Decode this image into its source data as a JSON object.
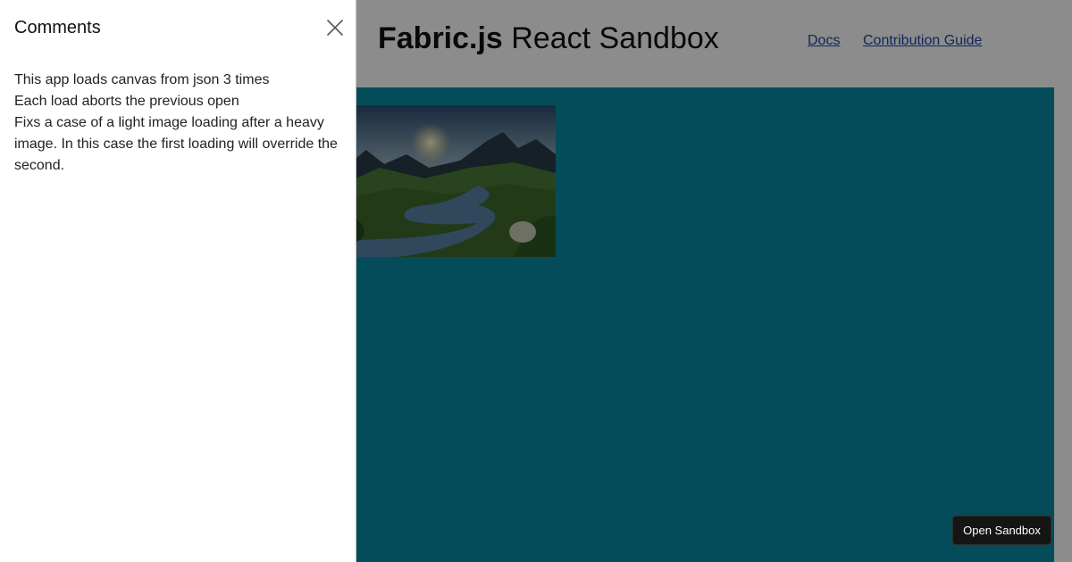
{
  "header": {
    "brand": "Fabric.js",
    "subtitle": "React Sandbox",
    "nav": [
      {
        "label": "Docs"
      },
      {
        "label": "Contribution Guide"
      }
    ]
  },
  "canvas": {
    "background_color": "#0a8aa5",
    "image_description_icon": "landscape-image"
  },
  "sandbox_button": {
    "label": "Open Sandbox"
  },
  "drawer": {
    "title": "Comments",
    "close_icon": "close-icon",
    "lines": [
      "This app loads canvas from json 3 times",
      "Each load aborts the previous open",
      "Fixs a case of a light image loading after a heavy image. In this case the first loading will override the second."
    ]
  }
}
